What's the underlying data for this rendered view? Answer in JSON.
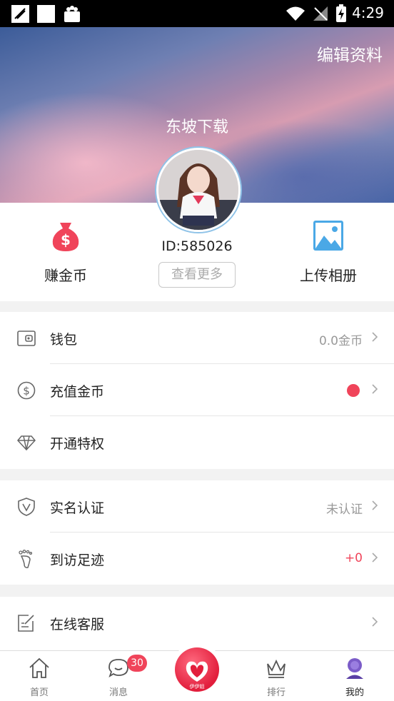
{
  "status_bar": {
    "time": "4:29"
  },
  "profile": {
    "edit_label": "编辑资料",
    "username": "东坡下载",
    "user_id": "ID:585026",
    "more_label": "查看更多"
  },
  "quick_actions": {
    "earn_label": "赚金币",
    "upload_label": "上传相册"
  },
  "menu": {
    "wallet": {
      "label": "钱包",
      "value": "0.0金币"
    },
    "recharge": {
      "label": "充值金币"
    },
    "privilege": {
      "label": "开通特权"
    },
    "verify": {
      "label": "实名认证",
      "value": "未认证"
    },
    "footprints": {
      "label": "到访足迹",
      "value": "+0"
    },
    "service": {
      "label": "在线客服"
    }
  },
  "tabbar": {
    "home": "首页",
    "messages": "消息",
    "messages_badge": "30",
    "center_label": "伊伊姐",
    "ranking": "排行",
    "mine": "我的"
  },
  "colors": {
    "accent": "#f0445a",
    "positive_value": "#f0445a",
    "icon_blue": "#4aa8e6"
  }
}
